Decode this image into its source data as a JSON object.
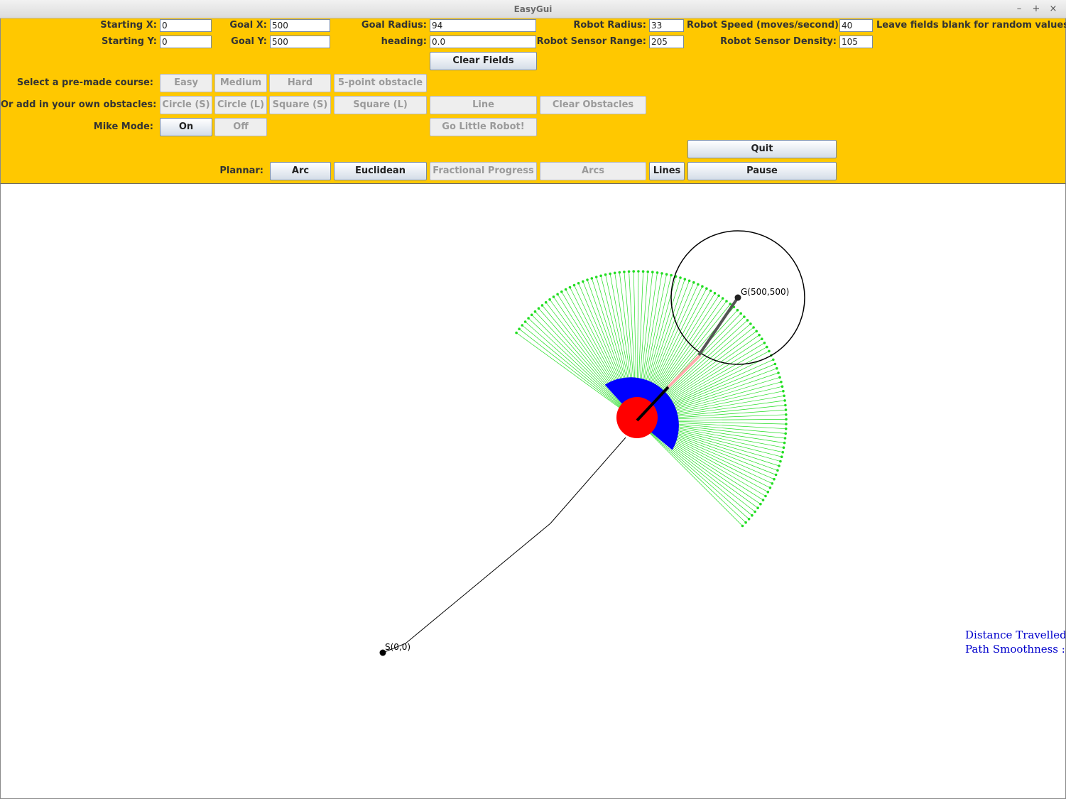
{
  "window": {
    "title": "EasyGui",
    "controls": {
      "minimize": "–",
      "maximize": "+",
      "close": "×"
    }
  },
  "fields": {
    "starting_x": {
      "label": "Starting X:",
      "value": "0"
    },
    "starting_y": {
      "label": "Starting Y:",
      "value": "0"
    },
    "goal_x": {
      "label": "Goal X:",
      "value": "500"
    },
    "goal_y": {
      "label": "Goal Y:",
      "value": "500"
    },
    "goal_radius": {
      "label": "Goal Radius:",
      "value": "94"
    },
    "heading": {
      "label": "heading:",
      "value": "0.0"
    },
    "robot_radius": {
      "label": "Robot Radius:",
      "value": "33"
    },
    "robot_sensor_range": {
      "label": "Robot Sensor Range:",
      "value": "205"
    },
    "robot_speed": {
      "label": "Robot Speed (moves/second):",
      "value": "40"
    },
    "robot_sensor_density": {
      "label": "Robot Sensor Density:",
      "value": "105"
    },
    "hint": "Leave fields blank for random values!"
  },
  "buttons": {
    "clear_fields": "Clear Fields",
    "course_label": "Select a pre-made course:",
    "easy": "Easy",
    "medium": "Medium",
    "hard": "Hard",
    "five_point": "5-point obstacle",
    "obstacles_label": "Or add in your own obstacles:",
    "circle_s": "Circle (S)",
    "circle_l": "Circle (L)",
    "square_s": "Square (S)",
    "square_l": "Square (L)",
    "line": "Line",
    "clear_obstacles": "Clear Obstacles",
    "mike_label": "Mike Mode:",
    "mike_on": "On",
    "mike_off": "Off",
    "go": "Go Little Robot!",
    "quit": "Quit",
    "plannar_label": "Plannar:",
    "arc": "Arc",
    "euclidean": "Euclidean",
    "fractional": "Fractional Progress",
    "arcs": "Arcs",
    "lines": "Lines",
    "pause": "Pause"
  },
  "canvas": {
    "start_label": "S(0,0)",
    "goal_label": "G(500,500)",
    "stat_distance": "Distance Travelled",
    "stat_smoothness": "Path Smoothness :",
    "colors": {
      "sensor": "#22dd22",
      "robot": "#ff0000",
      "sensor_arc": "#0000ff",
      "path": "#000000",
      "plan": "#ffaaaa",
      "stats": "#0000cc"
    }
  }
}
